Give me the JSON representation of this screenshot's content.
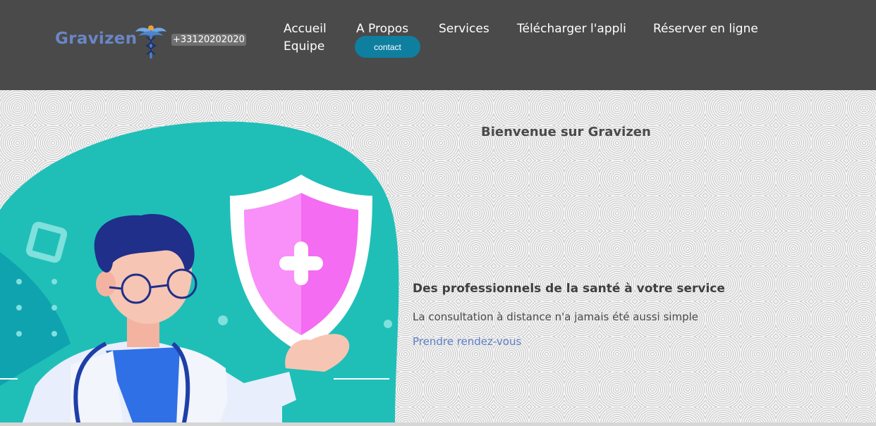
{
  "header": {
    "brand": "Gravizen",
    "phone": "+33120202020",
    "nav": {
      "accueil": "Accueil",
      "equipe": "Equipe",
      "apropos": "A Propos",
      "contact": "contact",
      "services": "Services",
      "telecharger": "Télécharger l'appli",
      "reserver": "Réserver en ligne"
    }
  },
  "hero": {
    "title": "Bienvenue sur Gravizen",
    "subtitle": "Des professionnels de la santé à votre service",
    "text": "La consultation à distance n'a jamais été aussi simple",
    "cta": "Prendre rendez-vous"
  },
  "colors": {
    "header_bg": "#4a4a4a",
    "brand": "#6a86c6",
    "contact_button": "#0f7fa0",
    "teal_blob": "#1fbfb8",
    "shield_pink": "#f777f2",
    "link": "#5d7ec7"
  },
  "icons": {
    "logo": "caduceus-icon",
    "shield": "medical-shield-icon"
  }
}
